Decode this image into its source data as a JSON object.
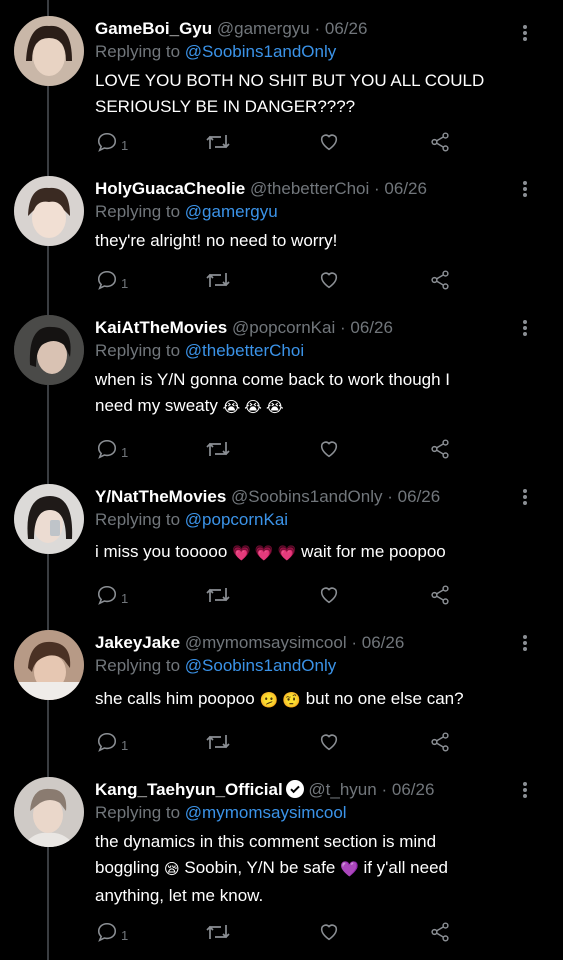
{
  "tweets": [
    {
      "name": "GameBoi_Gyu",
      "handle": "@gamergyu",
      "date": "06/26",
      "replying_label": "Replying to",
      "mention": "@Soobins1andOnly",
      "lines": [
        "LOVE YOU BOTH NO SHIT BUT YOU ALL COULD",
        "SERIOUSLY BE IN DANGER????"
      ],
      "reply_count": "1"
    },
    {
      "name": "HolyGuacaCheolie",
      "handle": "@thebetterChoi",
      "date": "06/26",
      "replying_label": "Replying to",
      "mention": "@gamergyu",
      "lines": [
        "they're alright! no need to worry!"
      ],
      "reply_count": "1"
    },
    {
      "name": "KaiAtTheMovies",
      "handle": "@popcornKai",
      "date": "06/26",
      "replying_label": "Replying to",
      "mention": "@thebetterChoi",
      "lines": [
        "when is Y/N gonna come back to work though I",
        "need my sweaty"
      ],
      "line2_emoji": "😭 😭 😭",
      "reply_count": "1"
    },
    {
      "name": "Y/NatTheMovies",
      "handle": "@Soobins1andOnly",
      "date": "06/26",
      "replying_label": "Replying to",
      "mention": "@popcornKai",
      "text_a": "i miss you tooooo",
      "emoji_a": "💗 💗 💗",
      "text_b": "wait for me poopoo",
      "reply_count": "1"
    },
    {
      "name": "JakeyJake",
      "handle": "@mymomsaysimcool",
      "date": "06/26",
      "replying_label": "Replying to",
      "mention": "@Soobins1andOnly",
      "text_a": "she calls him poopoo",
      "emoji_a": "🫤 🤨",
      "text_b": "but no one else can?",
      "reply_count": "1"
    },
    {
      "name": "Kang_Taehyun_Official",
      "handle": "@t_hyun",
      "date": "06/26",
      "replying_label": "Replying to",
      "mention": "@mymomsaysimcool",
      "line1": "the dynamics in this comment section is mind",
      "line2_a": "boggling",
      "emoji_a": "😪",
      "line2_b": "Soobin, Y/N be safe",
      "emoji_b": "💜",
      "line2_c": "if y'all need",
      "line3": "anything, let me know.",
      "reply_count": "1"
    }
  ],
  "separator": "·",
  "colors": {
    "background": "#000000",
    "link": "#3b93e8",
    "muted": "#71767b",
    "thread_line": "#3a3d41"
  },
  "icons": [
    "reply-icon",
    "retweet-icon",
    "like-icon",
    "share-icon",
    "more-icon",
    "verified-icon"
  ]
}
